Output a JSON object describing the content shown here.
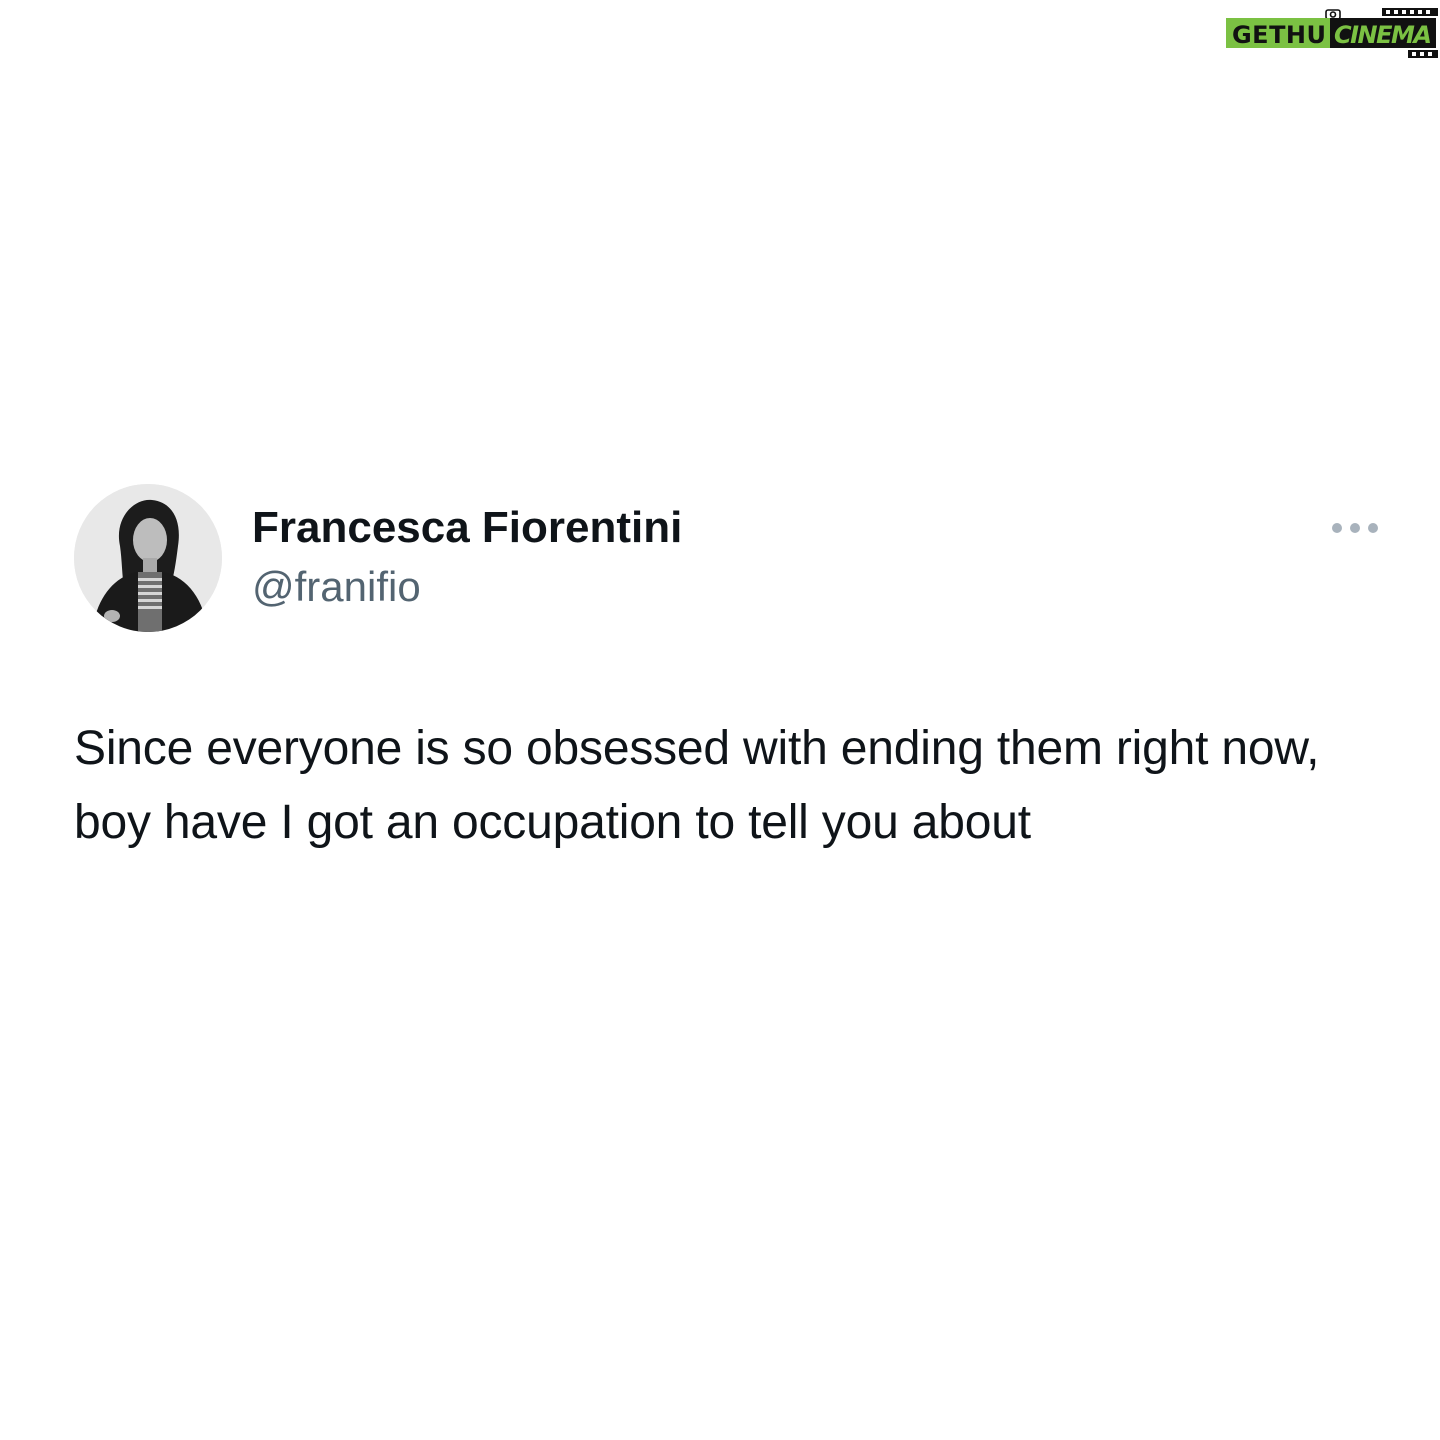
{
  "watermark": {
    "part1": "GETHU",
    "part2": "CINEMA",
    "colors": {
      "green": "#7bc143",
      "black": "#111111",
      "white": "#ffffff"
    }
  },
  "tweet": {
    "author": {
      "name": "Francesca Fiorentini",
      "handle": "@franifio",
      "avatar_icon": "profile-photo"
    },
    "more_icon": "more-horizontal-icon",
    "text": "Since everyone is so obsessed with ending them right now, boy have I got an occupation to tell you about"
  },
  "colors": {
    "background": "#ffffff",
    "text_primary": "#0f1419",
    "text_secondary": "#536471",
    "icon_muted": "#8b98a5"
  }
}
